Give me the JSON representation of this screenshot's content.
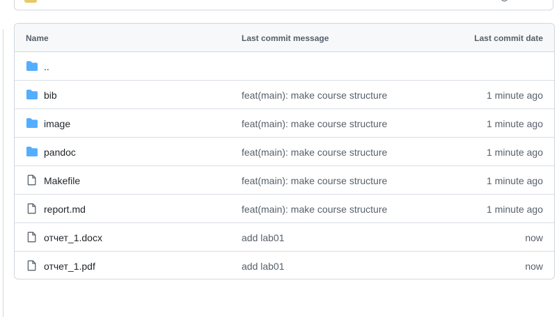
{
  "table": {
    "headers": {
      "name": "Name",
      "message": "Last commit message",
      "date": "Last commit date"
    },
    "parent_dir": "..",
    "rows": [
      {
        "name": "bib",
        "type": "folder",
        "message": "feat(main): make course structure",
        "date": "1 minute ago"
      },
      {
        "name": "image",
        "type": "folder",
        "message": "feat(main): make course structure",
        "date": "1 minute ago"
      },
      {
        "name": "pandoc",
        "type": "folder",
        "message": "feat(main): make course structure",
        "date": "1 minute ago"
      },
      {
        "name": "Makefile",
        "type": "file",
        "message": "feat(main): make course structure",
        "date": "1 minute ago"
      },
      {
        "name": "report.md",
        "type": "file",
        "message": "feat(main): make course structure",
        "date": "1 minute ago"
      },
      {
        "name": "отчет_1.docx",
        "type": "file",
        "message": "add lab01",
        "date": "now"
      },
      {
        "name": "отчет_1.pdf",
        "type": "file",
        "message": "add lab01",
        "date": "now"
      }
    ]
  },
  "colors": {
    "folder": "#54aeff",
    "border": "#d0d7de",
    "header_bg": "#f6f8fa",
    "muted_text": "#57606a",
    "text": "#1f2328"
  },
  "icons": {
    "folder": "folder-icon",
    "file": "file-icon"
  }
}
